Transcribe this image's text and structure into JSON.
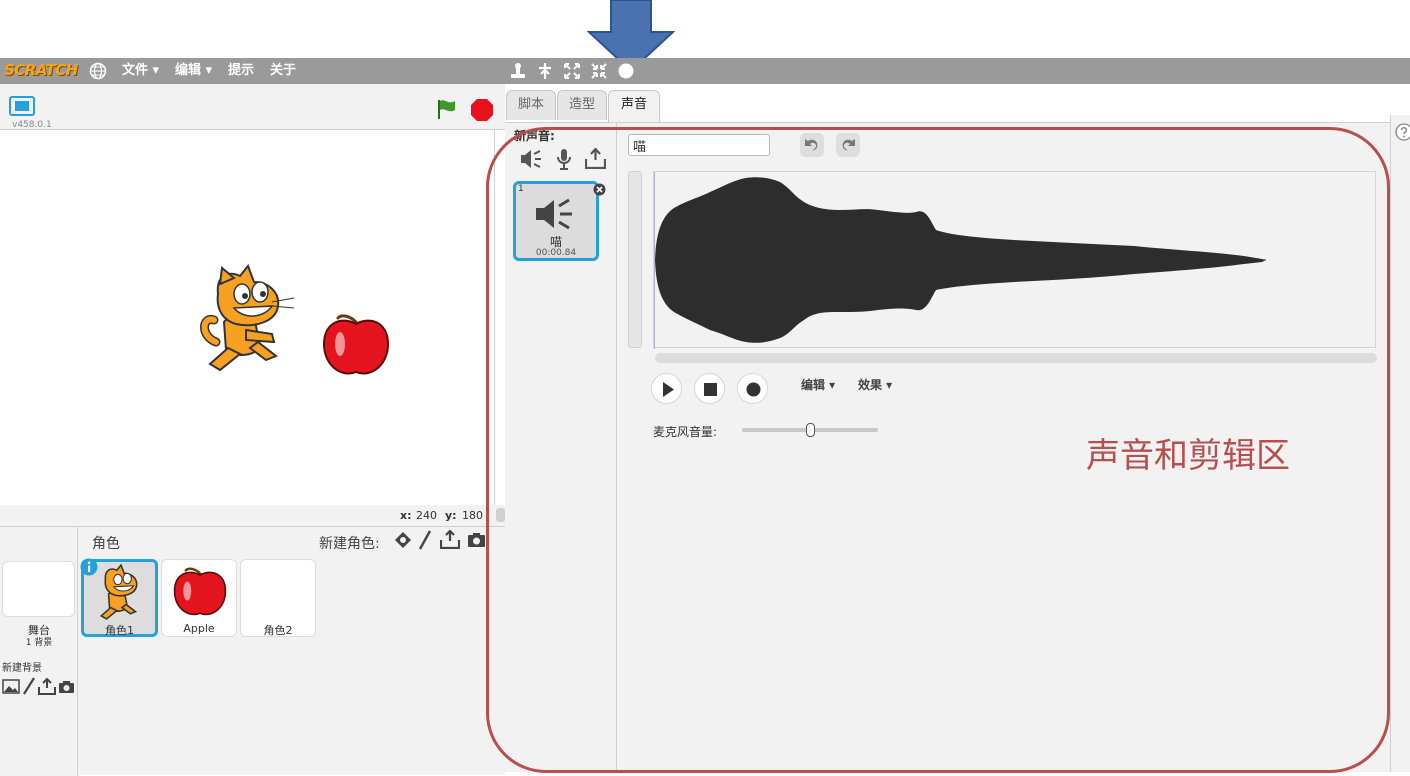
{
  "menubar": {
    "logo": "SCRATCH",
    "file": "文件 ▾",
    "edit": "编辑 ▾",
    "tips": "提示",
    "about": "关于"
  },
  "stage": {
    "version": "v458.0.1",
    "coord_x_label": "x:",
    "coord_x_value": "240",
    "coord_y_label": "y:",
    "coord_y_value": "180"
  },
  "sprites": {
    "header": "角色",
    "new_sprite_label": "新建角色:",
    "stage_label": "舞台",
    "stage_backdrops": "1 背景",
    "new_backdrop_label": "新建背景",
    "items": [
      {
        "name": "角色1",
        "selected": true
      },
      {
        "name": "Apple",
        "selected": false
      },
      {
        "name": "角色2",
        "selected": false
      }
    ]
  },
  "tabs": [
    "脚本",
    "造型",
    "声音"
  ],
  "active_tab": "声音",
  "sounds": {
    "new_sound_label": "新声音:",
    "items": [
      {
        "index": "1",
        "name": "喵",
        "duration": "00:00.84"
      }
    ]
  },
  "editor": {
    "sound_name_value": "喵",
    "edit_menu": "编辑 ▾",
    "effects_menu": "效果 ▾",
    "mic_volume_label": "麦克风音量:",
    "mic_volume_level": 0.5
  },
  "annotation": {
    "label": "声音和剪辑区",
    "color": "#b84e4e"
  },
  "colors": {
    "menubar": "#9a9a9a",
    "selected": "#25a0da",
    "arrow": "#4a72b0"
  }
}
